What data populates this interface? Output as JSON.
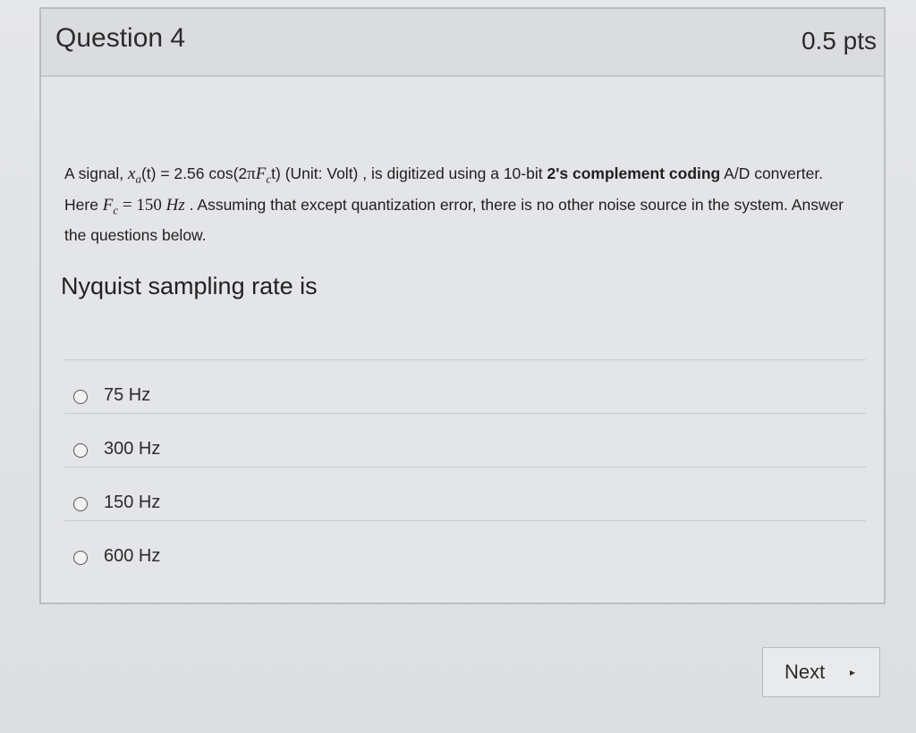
{
  "question": {
    "title": "Question 4",
    "points": "0.5 pts",
    "body": {
      "part1": "A signal, ",
      "signal_symbol": "x",
      "signal_subscript": "a",
      "signal_arg": "(t) = 2.56 cos(2",
      "pi": "π",
      "Fc_symbol": "F",
      "Fc_subscript": "c",
      "t_close": "t) (Unit: Volt) ,  is digitized using a 10-bit ",
      "bold1": "2's complement coding",
      "part2": " A/D converter.  Here ",
      "fc_eq_symbol": "F",
      "fc_eq_subscript": "c",
      "fc_value": " = 150 ",
      "fc_unit": "Hz",
      "part3": " . Assuming that except quantization error, there is no other noise source in the system.  Answer the questions below."
    },
    "prompt": "Nyquist sampling rate is",
    "answers": [
      {
        "label": "75 Hz"
      },
      {
        "label": "300 Hz"
      },
      {
        "label": "150 Hz"
      },
      {
        "label": "600 Hz"
      }
    ]
  },
  "navigation": {
    "next_label": "Next",
    "next_icon": "▸"
  }
}
